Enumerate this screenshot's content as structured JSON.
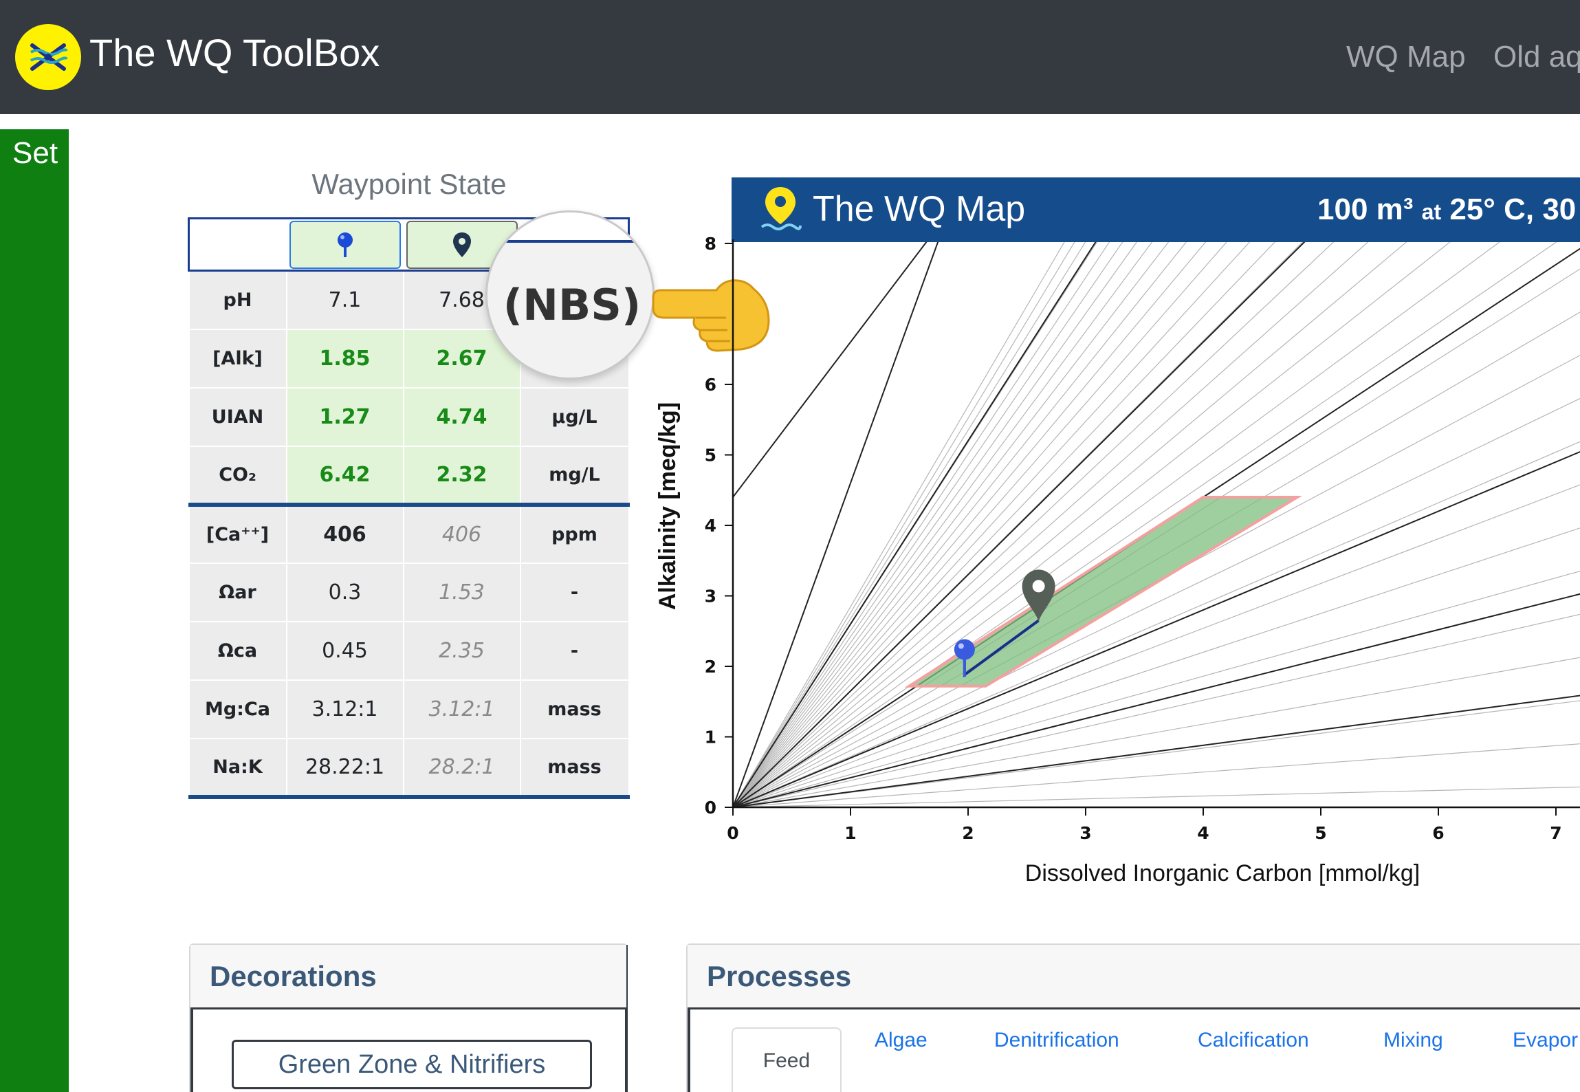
{
  "app": {
    "title": "The WQ ToolBox",
    "nav": [
      "WQ Map",
      "Old aq"
    ],
    "side_tab": "Set"
  },
  "waypoint": {
    "title": "Waypoint State",
    "magnifier_text": "(NBS)",
    "rows": [
      {
        "label": "pH",
        "v1": "7.1",
        "v2": "7.68",
        "unit": ""
      },
      {
        "label": "[Alk]",
        "v1": "1.85",
        "v2": "2.67",
        "unit": ""
      },
      {
        "label": "UIAN",
        "v1": "1.27",
        "v2": "4.74",
        "unit": "µg/L"
      },
      {
        "label": "CO₂",
        "v1": "6.42",
        "v2": "2.32",
        "unit": "mg/L"
      },
      {
        "label": "[Ca⁺⁺]",
        "v1": "406",
        "v2": "406",
        "unit": "ppm"
      },
      {
        "label": "Ωar",
        "v1": "0.3",
        "v2": "1.53",
        "unit": "-"
      },
      {
        "label": "Ωca",
        "v1": "0.45",
        "v2": "2.35",
        "unit": "-"
      },
      {
        "label": "Mg:Ca",
        "v1": "3.12:1",
        "v2": "3.12:1",
        "unit": "mass"
      },
      {
        "label": "Na:K",
        "v1": "28.22:1",
        "v2": "28.2:1",
        "unit": "mass"
      }
    ]
  },
  "map": {
    "title": "The WQ Map",
    "cond_main": "100 m³",
    "cond_small": "at",
    "cond_rest": "25° C, 30"
  },
  "chart_data": {
    "type": "scatter",
    "xlabel": "Dissolved Inorganic Carbon [mmol/kg]",
    "ylabel": "Alkalinity [meq/kg]",
    "xlim": [
      0,
      7.2
    ],
    "ylim": [
      0,
      8
    ],
    "xticks": [
      "0",
      "1",
      "2",
      "3",
      "4",
      "5",
      "6",
      "7"
    ],
    "yticks": [
      "0",
      "1",
      "2",
      "3",
      "4",
      "5",
      "6",
      "8"
    ],
    "green_zone": [
      [
        1.5,
        1.72
      ],
      [
        2.15,
        1.72
      ],
      [
        4.8,
        4.4
      ],
      [
        4.0,
        4.4
      ]
    ],
    "start_point": {
      "x": 1.97,
      "y": 2.2
    },
    "end_point": {
      "x": 2.6,
      "y": 2.65
    },
    "path": [
      [
        1.97,
        2.2
      ],
      [
        1.97,
        1.88
      ],
      [
        2.6,
        2.65
      ]
    ],
    "colors": {
      "green_zone": "#7fbf7f",
      "zone_border": "#f4a0a0",
      "start": "#3a5be0",
      "end": "#555e57",
      "path": "#1a2f8a"
    }
  },
  "panels": {
    "decorations_title": "Decorations",
    "green_zone_button": "Green Zone & Nitrifiers",
    "processes_title": "Processes",
    "tabs": [
      "Feed",
      "Algae",
      "Denitrification",
      "Calcification",
      "Mixing",
      "Evapor"
    ]
  }
}
